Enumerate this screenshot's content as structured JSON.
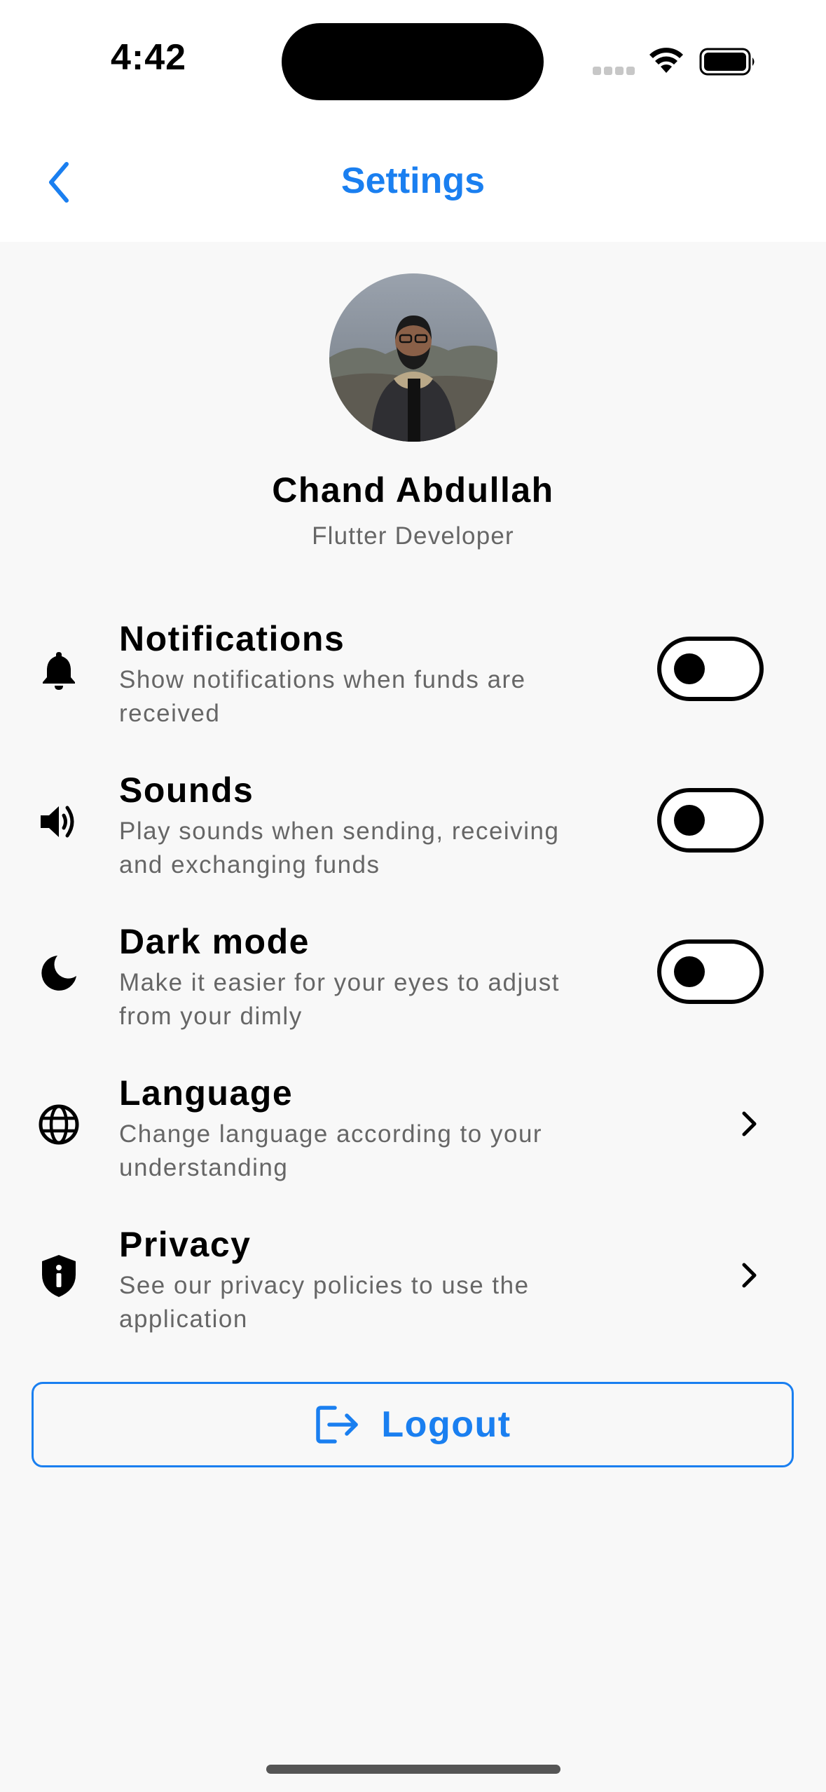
{
  "status_bar": {
    "time": "4:42",
    "icons": [
      "signal-icon",
      "wifi-icon",
      "battery-icon"
    ]
  },
  "header": {
    "title": "Settings",
    "back_icon": "chevron-left-icon",
    "accent_color": "#1a7ff0"
  },
  "profile": {
    "name": "Chand Abdullah",
    "role": "Flutter Developer"
  },
  "settings": [
    {
      "icon": "bell-icon",
      "title": "Notifications",
      "description": "Show notifications when funds are received",
      "control": "toggle",
      "enabled": false
    },
    {
      "icon": "speaker-icon",
      "title": "Sounds",
      "description": "Play sounds when sending, receiving and exchanging funds",
      "control": "toggle",
      "enabled": false
    },
    {
      "icon": "moon-icon",
      "title": "Dark mode",
      "description": "Make it easier for your eyes to adjust from your dimly",
      "control": "toggle",
      "enabled": false
    },
    {
      "icon": "globe-icon",
      "title": "Language",
      "description": "Change language according to your understanding",
      "control": "chevron"
    },
    {
      "icon": "shield-info-icon",
      "title": "Privacy",
      "description": "See our privacy policies to use the application",
      "control": "chevron"
    }
  ],
  "logout": {
    "label": "Logout",
    "icon": "logout-icon"
  }
}
